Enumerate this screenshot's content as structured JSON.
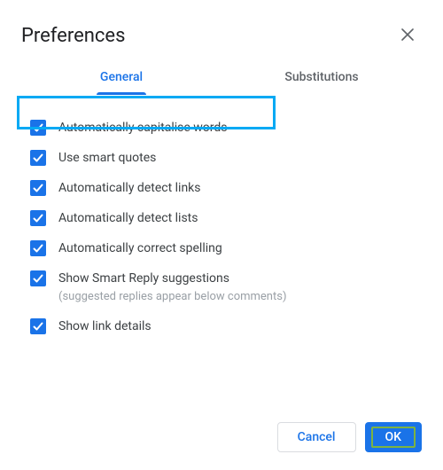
{
  "dialog": {
    "title": "Preferences"
  },
  "tabs": {
    "general": "General",
    "substitutions": "Substitutions"
  },
  "options": [
    {
      "label": "Automatically capitalise words",
      "checked": true
    },
    {
      "label": "Use smart quotes",
      "checked": true
    },
    {
      "label": "Automatically detect links",
      "checked": true
    },
    {
      "label": "Automatically detect lists",
      "checked": true
    },
    {
      "label": "Automatically correct spelling",
      "checked": true
    },
    {
      "label": "Show Smart Reply suggestions",
      "sub": "(suggested replies appear below comments)",
      "checked": true
    },
    {
      "label": "Show link details",
      "checked": true
    }
  ],
  "buttons": {
    "cancel": "Cancel",
    "ok": "OK"
  },
  "icons": {
    "close": "close-icon",
    "check": "check-icon"
  },
  "colors": {
    "accent": "#1a73e8",
    "highlight": "#03a9f4"
  }
}
